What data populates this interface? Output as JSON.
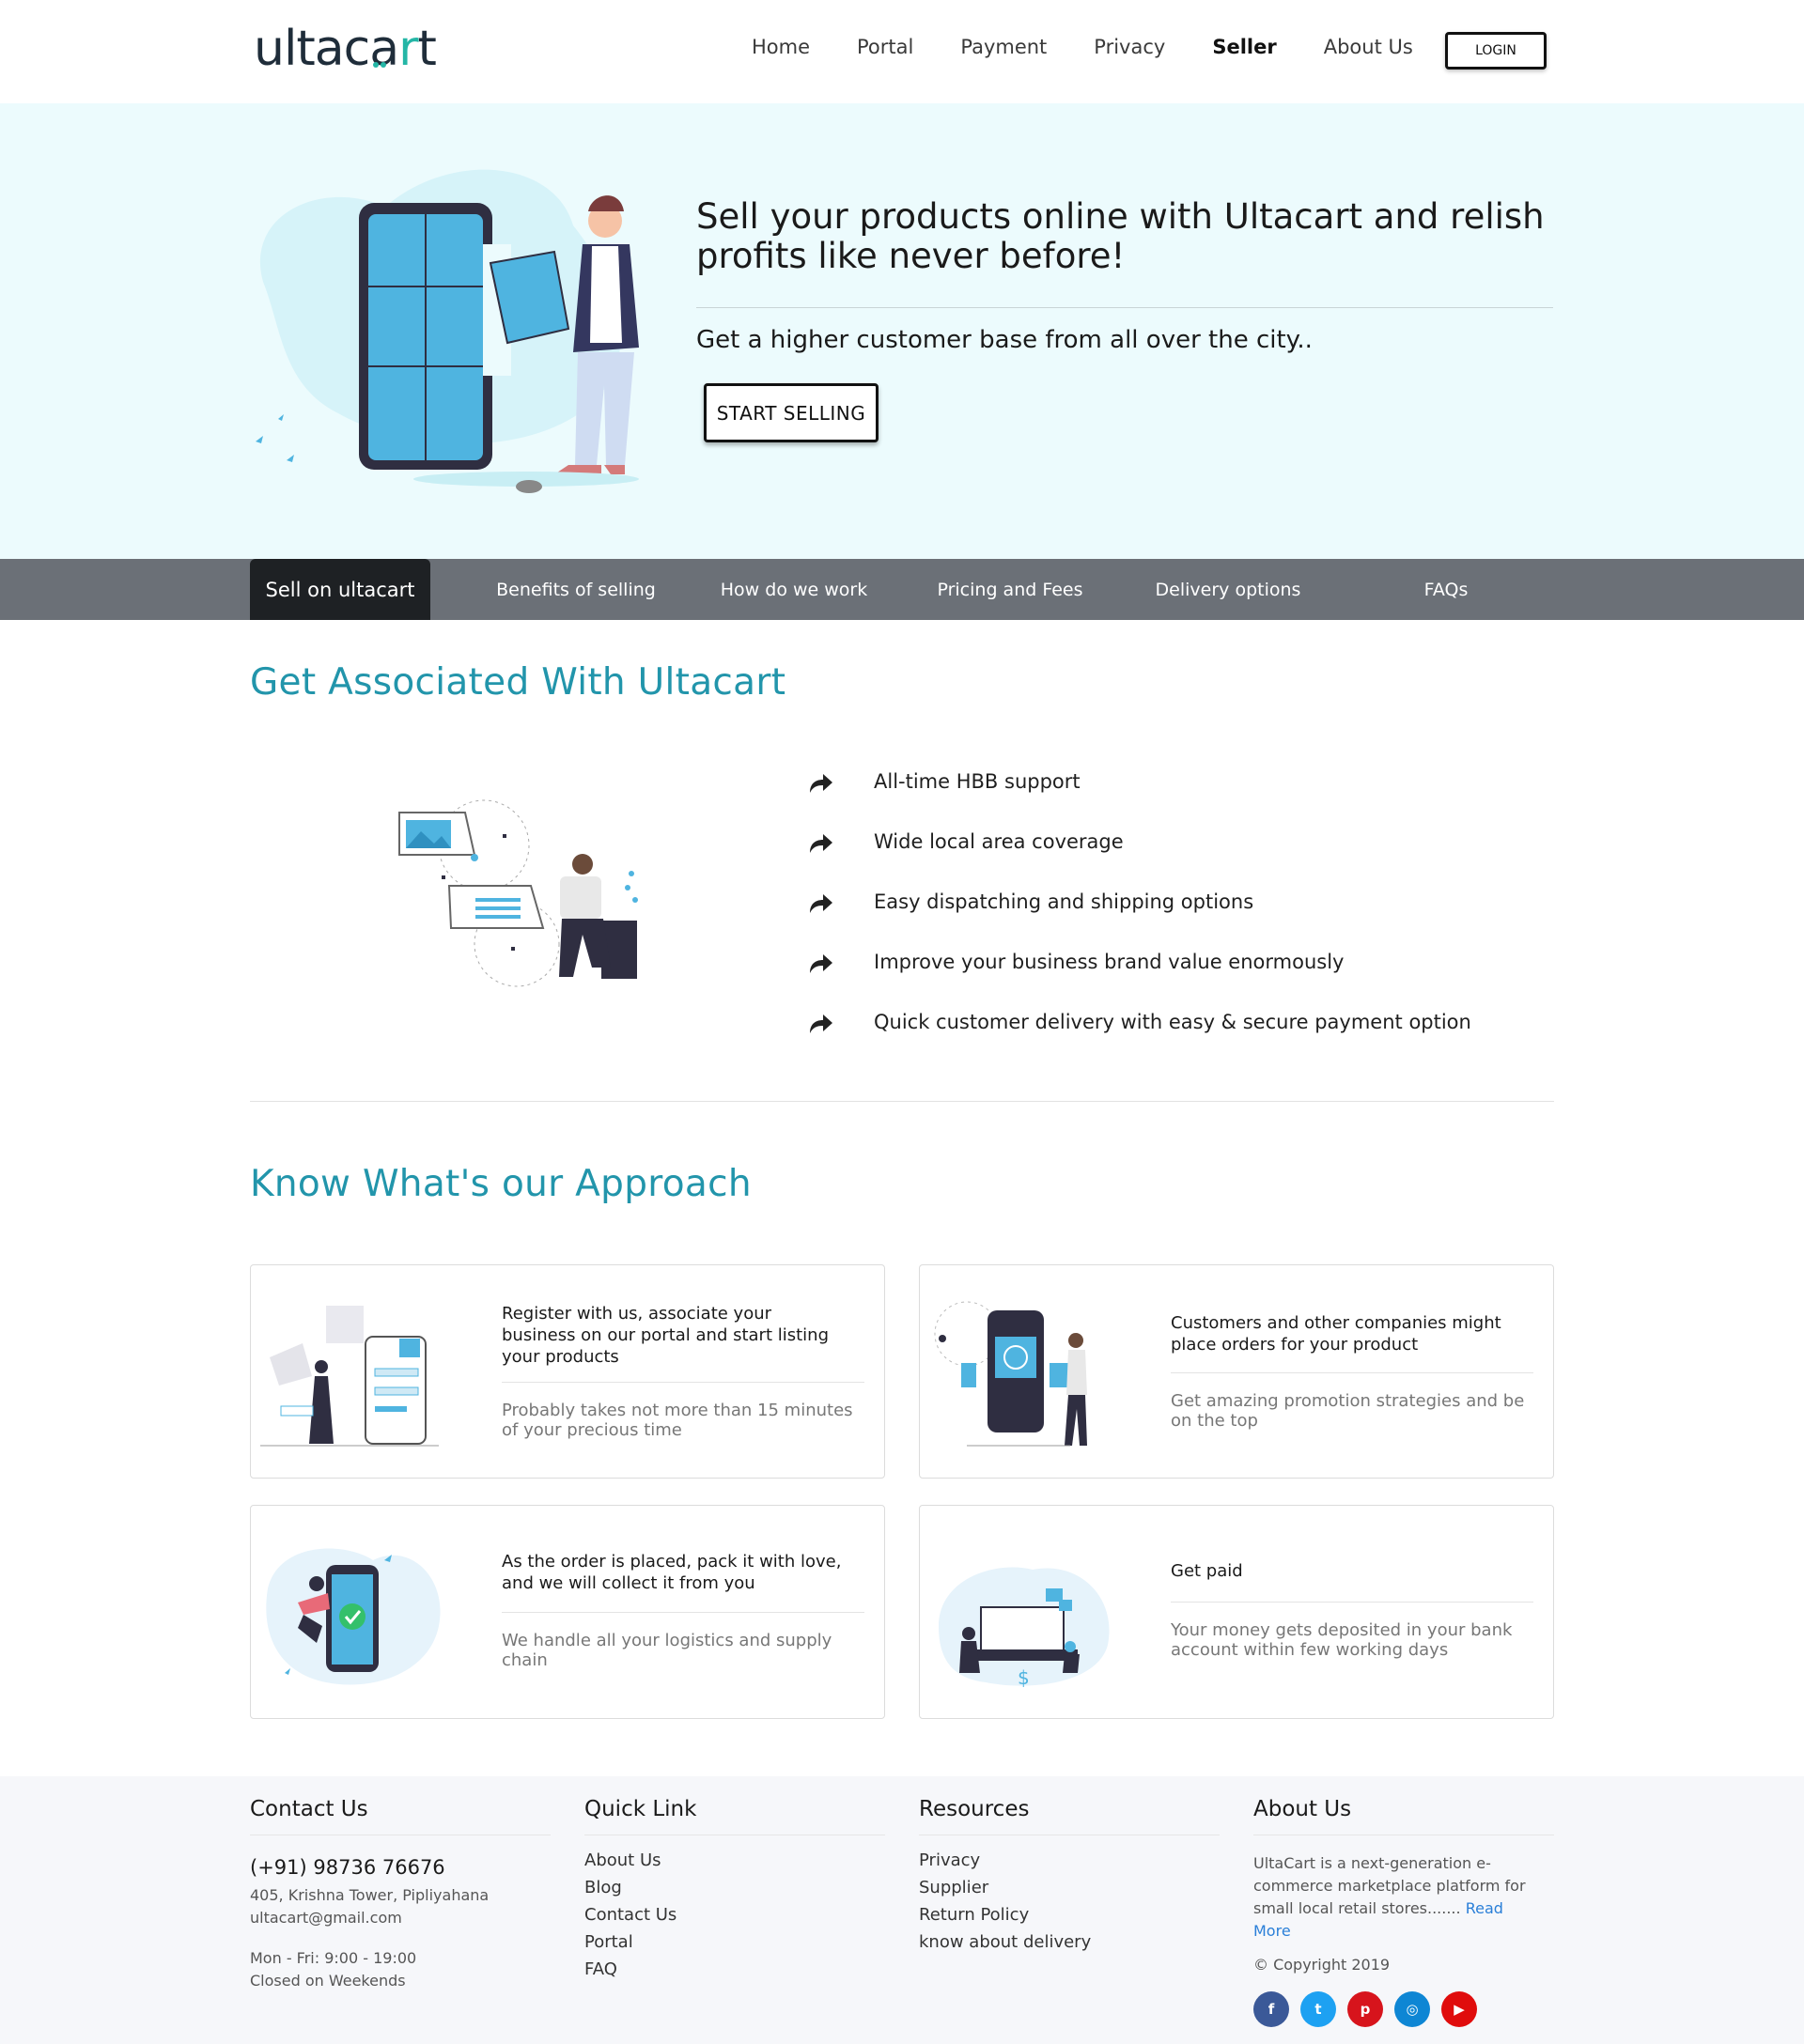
{
  "header": {
    "logo": {
      "text_main": "ultaca",
      "text_accent": "r",
      "text_end": "t"
    },
    "nav": [
      "Home",
      "Portal",
      "Payment",
      "Privacy",
      "Seller",
      "About Us"
    ],
    "active_nav": "Seller",
    "login_label": "LOGIN"
  },
  "hero": {
    "title": "Sell your products online with Ultacart and relish profits like never before!",
    "subtitle": "Get a higher customer base from all over the city..",
    "cta_label": "START SELLING"
  },
  "tabs": [
    "Sell on ultacart",
    "Benefits of selling",
    "How do we work",
    "Pricing and Fees",
    "Delivery options",
    "FAQs"
  ],
  "associated": {
    "title": "Get Associated With Ultacart",
    "features": [
      "All-time HBB support",
      "Wide local area coverage",
      "Easy dispatching and shipping options",
      "Improve your business brand value enormously",
      "Quick customer delivery with easy & secure payment option"
    ]
  },
  "approach": {
    "title": "Know What's our Approach",
    "cards": [
      {
        "title": "Register with us, associate your business on our portal and start listing your products",
        "desc": "Probably takes not more than 15 minutes of your precious time"
      },
      {
        "title": "Customers and other companies might place orders for your product",
        "desc": "Get amazing promotion strategies and be on the top"
      },
      {
        "title": "As the order is placed, pack it with love, and we will collect it from you",
        "desc": "We handle all your logistics and supply chain"
      },
      {
        "title": "Get paid",
        "desc": "Your money gets deposited in your bank account within few working days"
      }
    ]
  },
  "footer": {
    "contact": {
      "title": "Contact Us",
      "phone": "(+91) 98736 76676",
      "address": "405, Krishna Tower, Pipliyahana",
      "email": "ultacart@gmail.com",
      "hours": "Mon - Fri: 9:00 - 19:00",
      "closed": "Closed on Weekends"
    },
    "quick": {
      "title": "Quick Link",
      "links": [
        "About Us",
        "Blog",
        "Contact Us",
        "Portal",
        "FAQ"
      ]
    },
    "resources": {
      "title": "Resources",
      "links": [
        "Privacy",
        "Supplier",
        "Return Policy",
        "know about delivery"
      ]
    },
    "about": {
      "title": "About Us",
      "text": "UltaCart is a next-generation e-commerce marketplace platform for small local retail stores.......",
      "read_more": "Read More",
      "copyright": "© Copyright 2019"
    },
    "social": [
      {
        "name": "facebook",
        "glyph": "f",
        "color": "#3b5998"
      },
      {
        "name": "twitter",
        "glyph": "t",
        "color": "#1da1f2"
      },
      {
        "name": "pinterest",
        "glyph": "p",
        "color": "#d7141c"
      },
      {
        "name": "instagram",
        "glyph": "◎",
        "color": "#0e86d4"
      },
      {
        "name": "youtube",
        "glyph": "▶",
        "color": "#e00c0c"
      }
    ]
  },
  "colors": {
    "accent_teal": "#2295ab",
    "hero_bg": "#ecfbfd",
    "tab_bg": "#6b7077",
    "tab_active": "#1e2124",
    "illustration_blue": "#4fb4e0",
    "illustration_dark": "#2f2e41"
  }
}
